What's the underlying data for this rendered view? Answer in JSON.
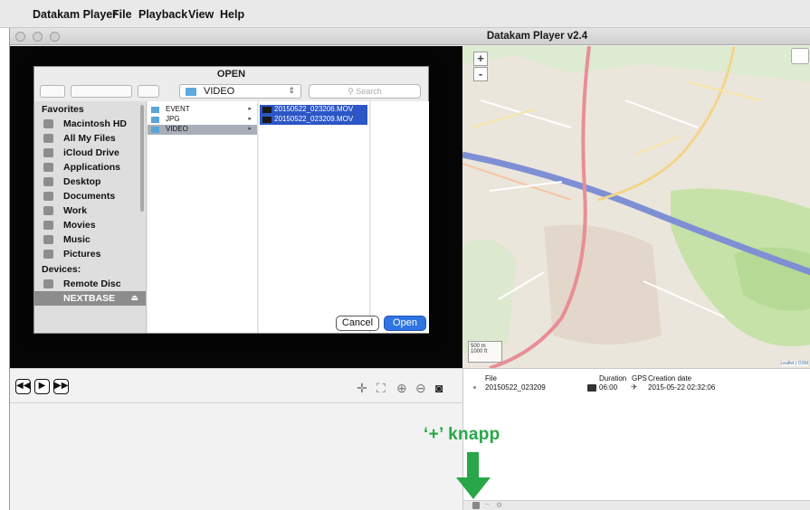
{
  "menubar": {
    "app": "Datakam Player",
    "items": [
      "File",
      "Playback",
      "View",
      "Help"
    ]
  },
  "window": {
    "title": "Datakam Player v2.4"
  },
  "dialog": {
    "title": "OPEN",
    "folder": "VIDEO",
    "search_placeholder": "Search",
    "favorites_heading": "Favorites",
    "favorites": [
      "Macintosh HD",
      "All My Files",
      "iCloud Drive",
      "Applications",
      "Desktop",
      "Documents",
      "Work",
      "Movies",
      "Music",
      "Pictures"
    ],
    "devices_heading": "Devices:",
    "devices": [
      "Remote Disc",
      "NEXTBASE"
    ],
    "folders": [
      "EVENT",
      "JPG",
      "VIDEO"
    ],
    "files": [
      "20150522_023206.MOV",
      "20150522_023209.MOV"
    ],
    "cancel_label": "Cancel",
    "open_label": "Open"
  },
  "map": {
    "zoom_in": "+",
    "zoom_out": "-",
    "scale_m": "500 m",
    "scale_ft": "1000 ft",
    "attribution": "Leaflet | OSM"
  },
  "playback": {
    "rewind": "◀◀",
    "play": "▶",
    "forward": "▶▶"
  },
  "filelist": {
    "headers": {
      "file": "File",
      "duration": "Duration",
      "gps": "GPS",
      "created": "Creation date"
    },
    "rows": [
      {
        "file": "20150522_023209",
        "duration": "06:00",
        "created": "2015-05-22  02:32:06"
      }
    ]
  },
  "annotation": {
    "label": "‘+’ knapp"
  },
  "colors": {
    "annotation_green": "#27a748",
    "open_button_blue": "#2f74e1",
    "selection_blue": "#2c56c5"
  }
}
